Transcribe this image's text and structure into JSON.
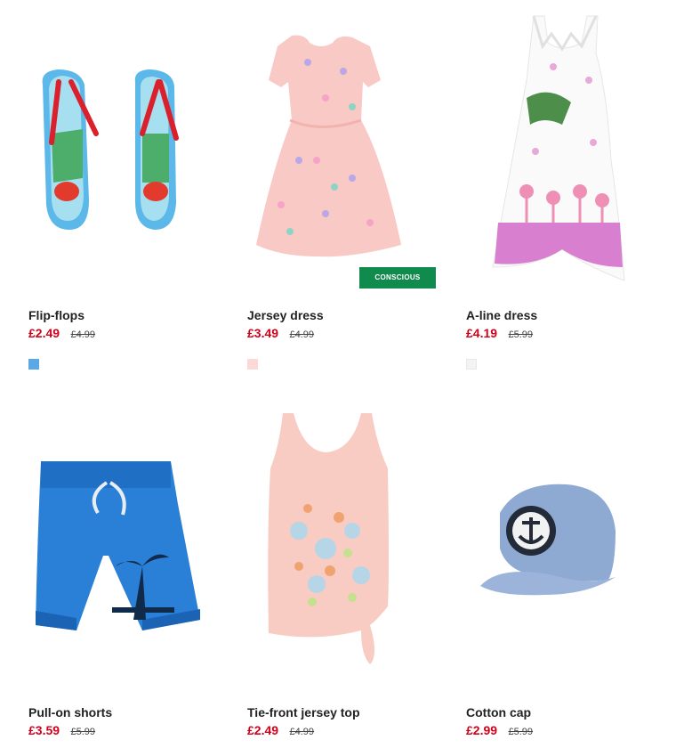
{
  "products": [
    {
      "name": "Flip-flops",
      "price": "£2.49",
      "old_price": "£4.99",
      "swatch": "#5aa9e6"
    },
    {
      "name": "Jersey dress",
      "price": "£3.49",
      "old_price": "£4.99",
      "swatch": "#fbd9d6",
      "badge": "CONSCIOUS"
    },
    {
      "name": "A-line dress",
      "price": "£4.19",
      "old_price": "£5.99",
      "swatch": "#f3f3f3"
    },
    {
      "name": "Pull-on shorts",
      "price": "£3.59",
      "old_price": "£5.99"
    },
    {
      "name": "Tie-front jersey top",
      "price": "£2.49",
      "old_price": "£4.99"
    },
    {
      "name": "Cotton cap",
      "price": "£2.99",
      "old_price": "£5.99"
    }
  ],
  "colors": {
    "sale": "#d0021b",
    "conscious_badge": "#118a4e"
  },
  "icons": [
    "flip-flops-image",
    "jersey-dress-image",
    "a-line-dress-image",
    "pull-on-shorts-image",
    "tie-front-top-image",
    "cotton-cap-image"
  ]
}
